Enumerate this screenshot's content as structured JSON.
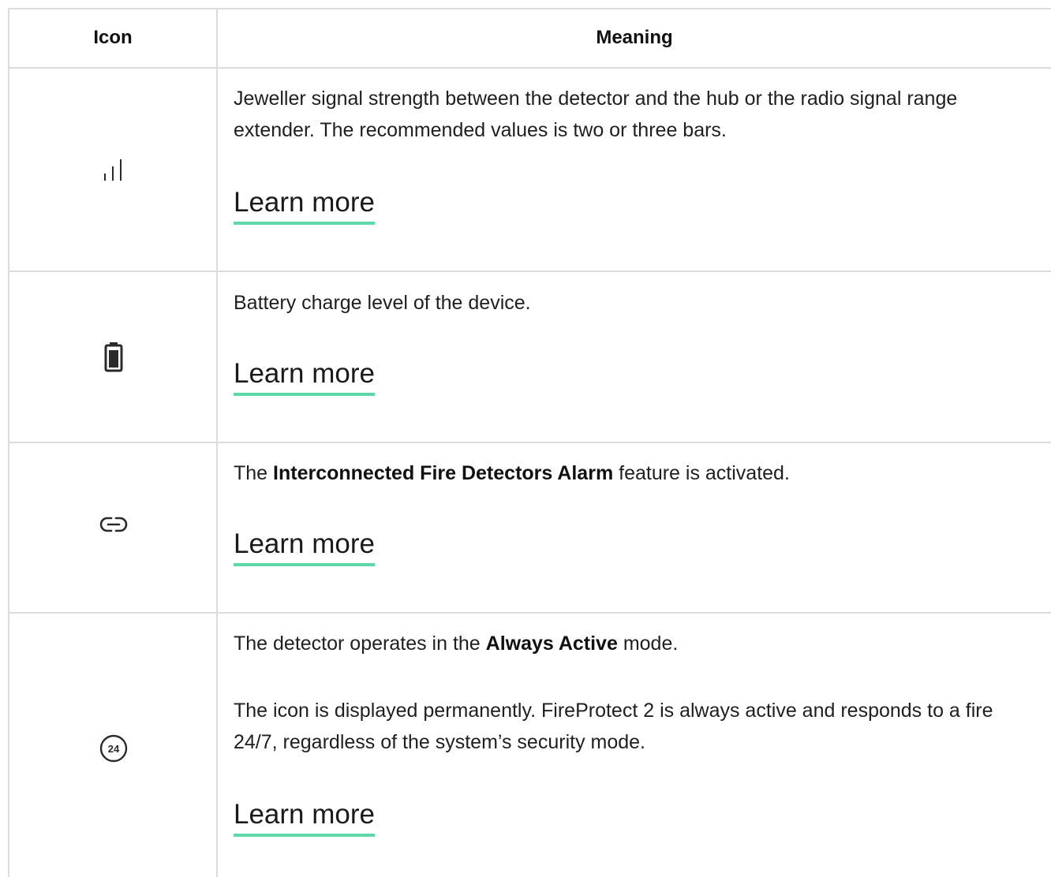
{
  "table": {
    "headers": {
      "icon": "Icon",
      "meaning": "Meaning"
    },
    "rows": [
      {
        "icon": "signal-strength-icon",
        "text": "Jeweller signal strength between the detector and the hub or the radio signal range extender. The recommended values is two or three bars.",
        "link": "Learn more"
      },
      {
        "icon": "battery-icon",
        "text": "Battery charge level of the device.",
        "link": "Learn more"
      },
      {
        "icon": "link-icon",
        "text_before": "The ",
        "text_bold": "Interconnected Fire Detectors Alarm",
        "text_after": " feature is activated.",
        "link": "Learn more"
      },
      {
        "icon": "always-active-24-icon",
        "icon_label": "24",
        "text_before": "The detector operates in the ",
        "text_bold": "Always Active",
        "text_after": " mode.",
        "text_2": "The icon is displayed permanently. FireProtect 2 is always active and responds to a fire 24/7, regardless of the system’s security mode.",
        "link": "Learn more"
      }
    ]
  },
  "colors": {
    "border": "#dcdcdc",
    "link_underline": "#5fd8a8",
    "text": "#1f1f1f"
  }
}
